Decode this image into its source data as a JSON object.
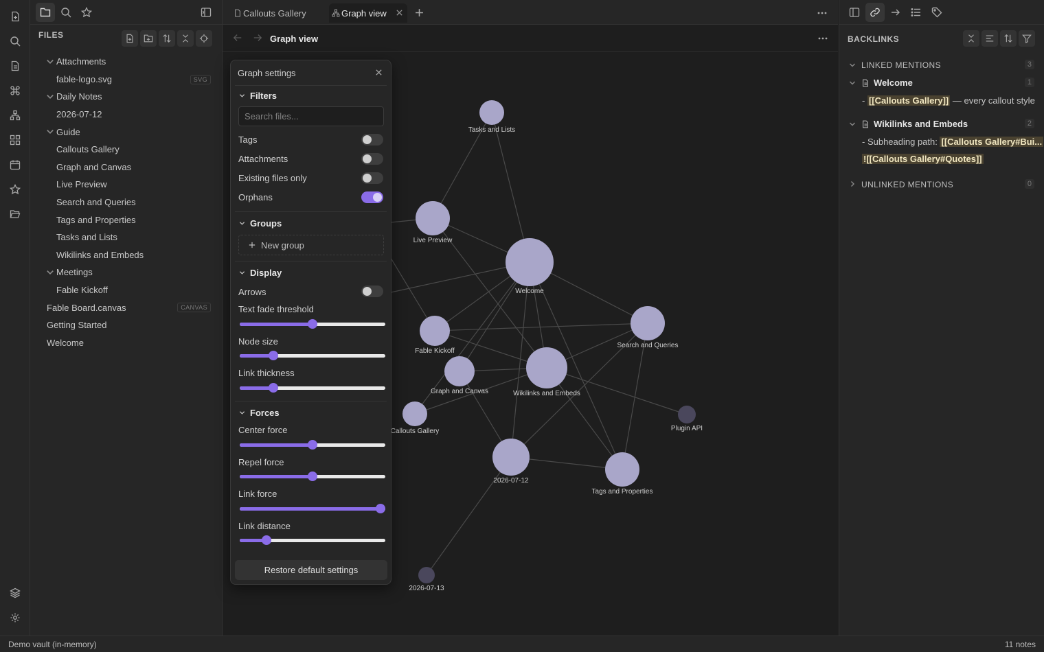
{
  "left_sidebar": {
    "files_header": "FILES",
    "tree": [
      {
        "label": "Attachments",
        "type": "folder",
        "depth": 1
      },
      {
        "label": "fable-logo.svg",
        "type": "file",
        "depth": 2,
        "badge": "SVG"
      },
      {
        "label": "Daily Notes",
        "type": "folder",
        "depth": 1
      },
      {
        "label": "2026-07-12",
        "type": "file",
        "depth": 2
      },
      {
        "label": "Guide",
        "type": "folder",
        "depth": 1
      },
      {
        "label": "Callouts Gallery",
        "type": "file",
        "depth": 2
      },
      {
        "label": "Graph and Canvas",
        "type": "file",
        "depth": 2
      },
      {
        "label": "Live Preview",
        "type": "file",
        "depth": 2
      },
      {
        "label": "Search and Queries",
        "type": "file",
        "depth": 2
      },
      {
        "label": "Tags and Properties",
        "type": "file",
        "depth": 2
      },
      {
        "label": "Tasks and Lists",
        "type": "file",
        "depth": 2
      },
      {
        "label": "Wikilinks and Embeds",
        "type": "file",
        "depth": 2
      },
      {
        "label": "Meetings",
        "type": "folder",
        "depth": 1
      },
      {
        "label": "Fable Kickoff",
        "type": "file",
        "depth": 2
      },
      {
        "label": "Fable Board.canvas",
        "type": "file",
        "depth": 0,
        "badge": "CANVAS"
      },
      {
        "label": "Getting Started",
        "type": "file",
        "depth": 0
      },
      {
        "label": "Welcome",
        "type": "file",
        "depth": 0
      }
    ]
  },
  "tabs": [
    {
      "label": "Callouts Gallery",
      "icon": "document-icon",
      "active": false
    },
    {
      "label": "Graph view",
      "icon": "graph-icon",
      "active": true
    }
  ],
  "view": {
    "title": "Graph view"
  },
  "graph_settings": {
    "title": "Graph settings",
    "filters": {
      "title": "Filters",
      "search_placeholder": "Search files...",
      "options": [
        {
          "label": "Tags",
          "on": false
        },
        {
          "label": "Attachments",
          "on": false
        },
        {
          "label": "Existing files only",
          "on": false
        },
        {
          "label": "Orphans",
          "on": true
        }
      ]
    },
    "groups": {
      "title": "Groups",
      "new_group": "New group"
    },
    "display": {
      "title": "Display",
      "arrows_label": "Arrows",
      "arrows_on": false,
      "sliders": [
        {
          "label": "Text fade threshold",
          "value": 0.5
        },
        {
          "label": "Node size",
          "value": 0.21
        },
        {
          "label": "Link thickness",
          "value": 0.21
        }
      ]
    },
    "forces": {
      "title": "Forces",
      "sliders": [
        {
          "label": "Center force",
          "value": 0.5
        },
        {
          "label": "Repel force",
          "value": 0.5
        },
        {
          "label": "Link force",
          "value": 1.0
        },
        {
          "label": "Link distance",
          "value": 0.16
        }
      ]
    },
    "restore_label": "Restore default settings"
  },
  "graph": {
    "nodes": [
      {
        "id": "tasks",
        "label": "Tasks and Lists",
        "orphan": false
      },
      {
        "id": "live",
        "label": "Live Preview",
        "orphan": false
      },
      {
        "id": "welcome",
        "label": "Welcome",
        "orphan": false
      },
      {
        "id": "search",
        "label": "Search and Queries",
        "orphan": false
      },
      {
        "id": "kickoff",
        "label": "Fable Kickoff",
        "orphan": false
      },
      {
        "id": "gc",
        "label": "Graph and Canvas",
        "orphan": false
      },
      {
        "id": "wiki",
        "label": "Wikilinks and Embeds",
        "orphan": false
      },
      {
        "id": "callouts",
        "label": "Callouts Gallery",
        "orphan": false
      },
      {
        "id": "plugin",
        "label": "Plugin API",
        "orphan": true
      },
      {
        "id": "d12",
        "label": "2026-07-12",
        "orphan": false
      },
      {
        "id": "tags",
        "label": "Tags and Properties",
        "orphan": false
      },
      {
        "id": "d13",
        "label": "2026-07-13",
        "orphan": true
      }
    ],
    "node_color": "#a9a6c9",
    "orphan_color": "#4a475c",
    "link_color": "#4a4a4a"
  },
  "backlinks": {
    "header": "BACKLINKS",
    "linked": {
      "title": "LINKED MENTIONS",
      "count": "3",
      "files": [
        {
          "name": "Welcome",
          "count": "1",
          "snippets": [
            {
              "prefix": "- ",
              "link": "[[Callouts Gallery]]",
              "suffix": " — every callout style"
            }
          ]
        },
        {
          "name": "Wikilinks and Embeds",
          "count": "2",
          "snippets": [
            {
              "prefix": "- Subheading path: ",
              "link": "[[Callouts Gallery#Bui...",
              "suffix": ""
            },
            {
              "prefix": "",
              "link": "![[Callouts Gallery#Quotes]]",
              "suffix": ""
            }
          ]
        }
      ]
    },
    "unlinked": {
      "title": "UNLINKED MENTIONS",
      "count": "0"
    }
  },
  "status": {
    "left": "Demo vault (in-memory)",
    "right": "11 notes"
  },
  "accent": "#8a6ce8"
}
